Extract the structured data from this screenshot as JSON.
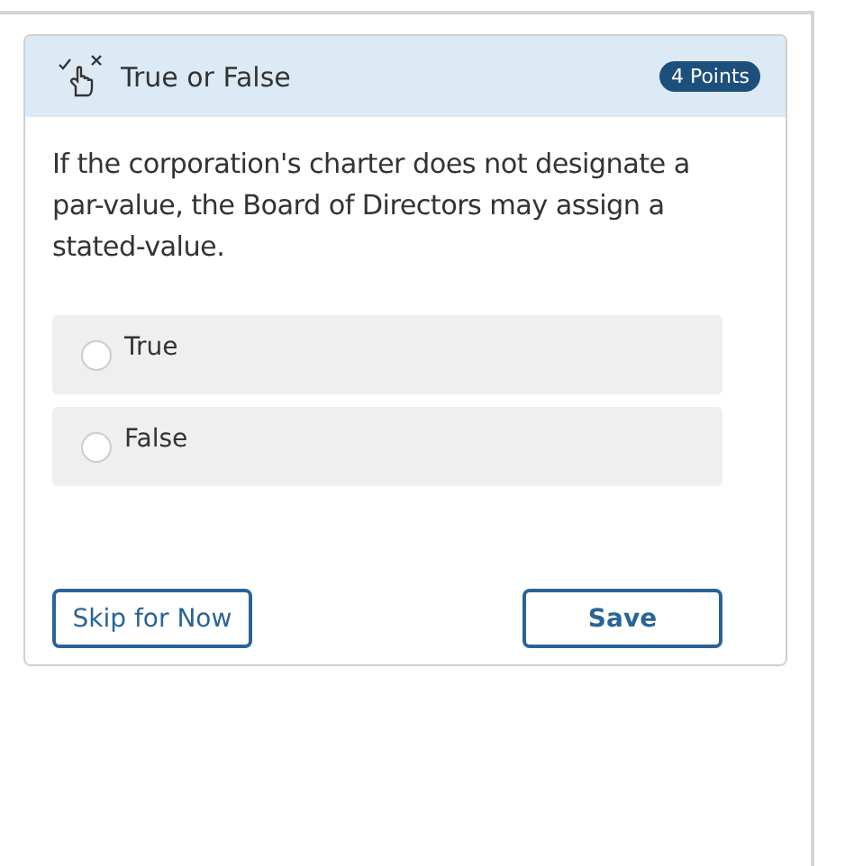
{
  "question": {
    "type": "True or False",
    "points": "4 Points",
    "prompt": "If the corporation's charter does not designate a par-value, the Board of Directors may assign a stated-value."
  },
  "options": [
    {
      "label": "True",
      "selected": false
    },
    {
      "label": "False",
      "selected": false
    }
  ],
  "buttons": {
    "skip": "Skip for Now",
    "save": "Save"
  }
}
